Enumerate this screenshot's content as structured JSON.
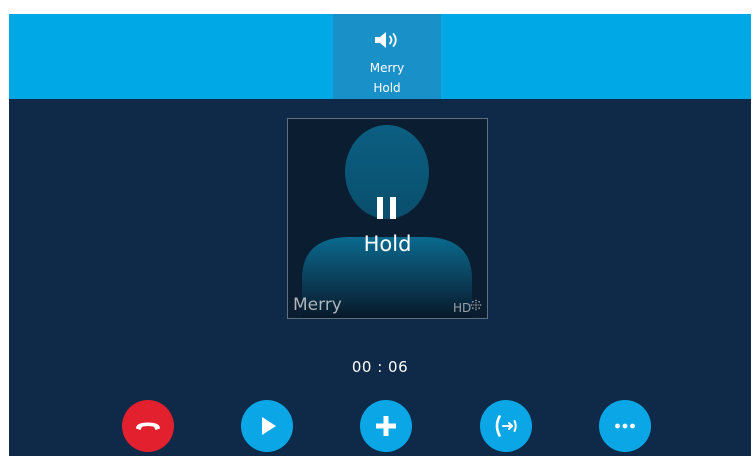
{
  "call_tab": {
    "name": "Merry",
    "state": "Hold",
    "icon": "speaker-icon"
  },
  "contact_card": {
    "status_icon": "pause-icon",
    "status": "Hold",
    "caller_name": "Merry",
    "hd_badge": "HD"
  },
  "timer": "00 : 06",
  "softkeys": [
    {
      "name": "end-call-button",
      "icon": "hang-up-icon",
      "color": "#e3202e"
    },
    {
      "name": "resume-button",
      "icon": "play-icon",
      "color": "#0aa6e6"
    },
    {
      "name": "new-call-button",
      "icon": "plus-icon",
      "color": "#0aa6e6"
    },
    {
      "name": "transfer-button",
      "icon": "transfer-icon",
      "color": "#0aa6e6"
    },
    {
      "name": "more-button",
      "icon": "ellipsis-icon",
      "color": "#0aa6e6"
    }
  ],
  "colors": {
    "top_bar": "#00a8e6",
    "active_tab": "#1a90c8",
    "background": "#0e2a48",
    "end_call": "#e3202e",
    "accent": "#0aa6e6"
  }
}
